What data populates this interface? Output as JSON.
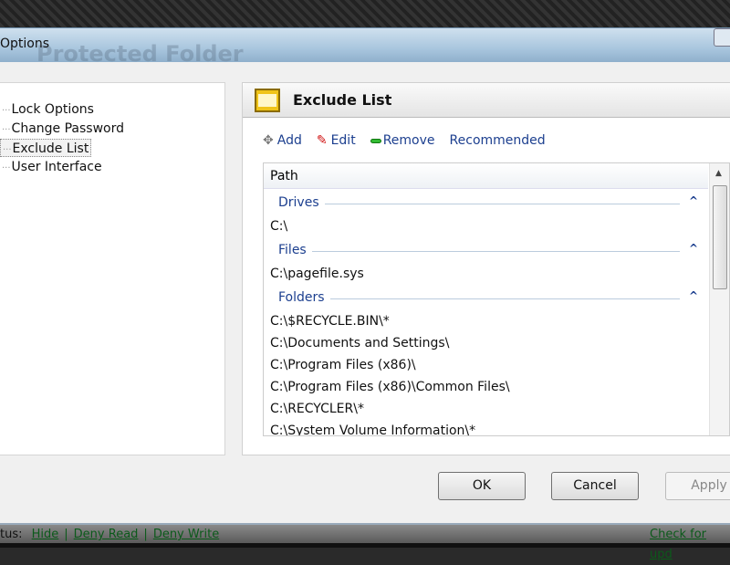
{
  "window": {
    "title": "Options",
    "background_title": "Protected Folder"
  },
  "tree": {
    "items": [
      {
        "label": "Lock Options"
      },
      {
        "label": "Change Password"
      },
      {
        "label": "Exclude List",
        "selected": true
      },
      {
        "label": "User Interface"
      }
    ]
  },
  "panel": {
    "title": "Exclude List",
    "icon": "barrier-icon",
    "toolbar": {
      "add": "Add",
      "edit": "Edit",
      "remove": "Remove",
      "recommended": "Recommended"
    },
    "list": {
      "column": "Path",
      "groups": [
        {
          "name": "Drives",
          "items": [
            "C:\\"
          ]
        },
        {
          "name": "Files",
          "items": [
            "C:\\pagefile.sys"
          ]
        },
        {
          "name": "Folders",
          "items": [
            "C:\\$RECYCLE.BIN\\*",
            "C:\\Documents and Settings\\",
            "C:\\Program Files (x86)\\",
            "C:\\Program Files (x86)\\Common Files\\",
            "C:\\RECYCLER\\*",
            "C:\\System Volume Information\\*"
          ]
        }
      ]
    }
  },
  "buttons": {
    "ok": "OK",
    "cancel": "Cancel",
    "apply": "Apply"
  },
  "status": {
    "label": "tus:",
    "hide": "Hide",
    "deny_read": "Deny Read",
    "deny_write": "Deny Write",
    "sep": "|",
    "check": "Check for upd"
  },
  "colors": {
    "link": "#1c3f8f",
    "status_link": "#0b5a1a"
  }
}
